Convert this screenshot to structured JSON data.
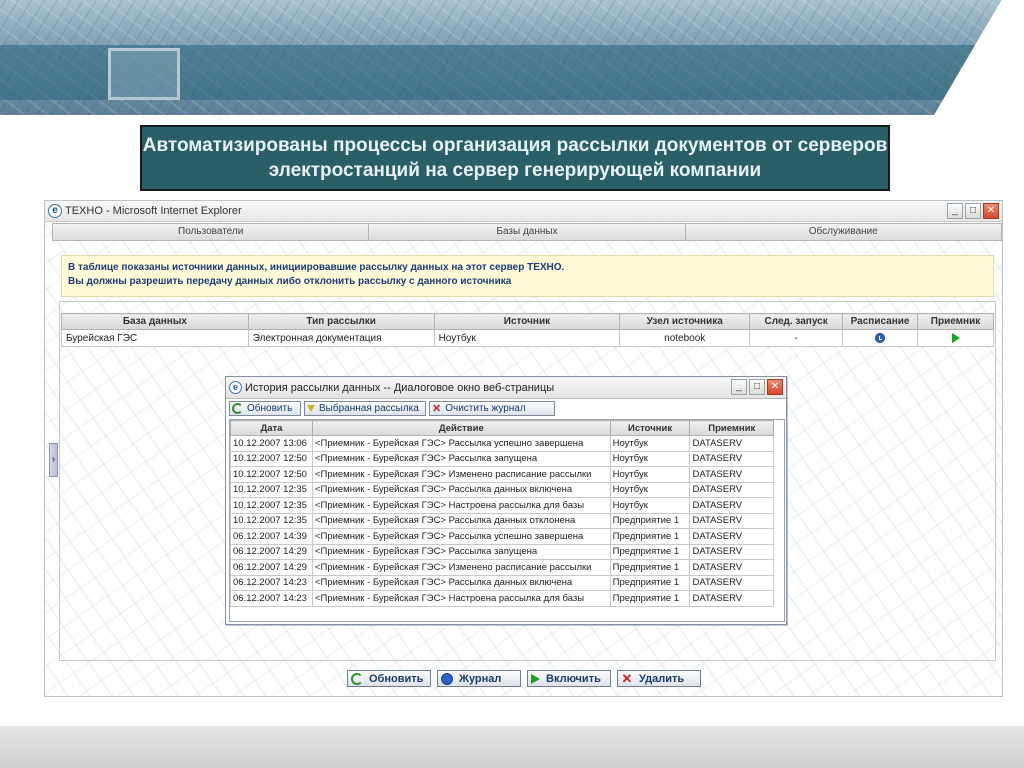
{
  "slide": {
    "title": "Автоматизированы процессы организация рассылки документов от серверов электростанций на сервер генерирующей компании"
  },
  "browser": {
    "window_title": "ТЕХНО - Microsoft Internet Explorer",
    "buttons": {
      "minimize": "_",
      "maximize": "□",
      "close": "✕"
    }
  },
  "nav": {
    "tabs": [
      "Пользователи",
      "Базы данных",
      "Обслуживание"
    ]
  },
  "info": {
    "line1": "В таблице показаны источники данных, инициировавшие рассылку данных на этот сервер ТЕХНО.",
    "line2": "Вы должны разрешить передачу данных либо отклонить рассылку с данного источника"
  },
  "sources_table": {
    "headers": [
      "База данных",
      "Тип рассылки",
      "Источник",
      "Узел источника",
      "След. запуск",
      "Расписание",
      "Приемник"
    ],
    "rows": [
      {
        "database": "Бурейская ГЭС",
        "type": "Электронная документация",
        "source": "Ноутбук",
        "node": "notebook",
        "next_run": "-",
        "schedule_icon": "clock-icon",
        "receiver_icon": "play-icon"
      }
    ]
  },
  "bottom_buttons": {
    "refresh": "Обновить",
    "journal": "Журнал",
    "enable": "Включить",
    "delete": "Удалить"
  },
  "dialog": {
    "title": "История рассылки данных -- Диалоговое окно веб-страницы",
    "toolbar": {
      "refresh": "Обновить",
      "filter": "Выбранная рассылка",
      "clear": "Очистить журнал"
    },
    "headers": [
      "Дата",
      "Действие",
      "Источник",
      "Приемник"
    ],
    "rows": [
      {
        "date": "10.12.2007 13:06",
        "action": "<Приемник - Бурейская ГЭС> Рассылка успешно завершена",
        "source": "Ноутбук",
        "receiver": "DATASERV"
      },
      {
        "date": "10.12.2007 12:50",
        "action": "<Приемник - Бурейская ГЭС> Рассылка запущена",
        "source": "Ноутбук",
        "receiver": "DATASERV"
      },
      {
        "date": "10.12.2007 12:50",
        "action": "<Приемник - Бурейская ГЭС> Изменено расписание рассылки",
        "source": "Ноутбук",
        "receiver": "DATASERV"
      },
      {
        "date": "10.12.2007 12:35",
        "action": "<Приемник - Бурейская ГЭС> Рассылка данных включена",
        "source": "Ноутбук",
        "receiver": "DATASERV"
      },
      {
        "date": "10.12.2007 12:35",
        "action": "<Приемник - Бурейская ГЭС> Настроена рассылка для базы",
        "source": "Ноутбук",
        "receiver": "DATASERV"
      },
      {
        "date": "10.12.2007 12:35",
        "action": "<Приемник - Бурейская ГЭС> Рассылка данных отклонена",
        "source": "Предприятие 1",
        "receiver": "DATASERV"
      },
      {
        "date": "06.12.2007 14:39",
        "action": "<Приемник - Бурейская ГЭС> Рассылка успешно завершена",
        "source": "Предприятие 1",
        "receiver": "DATASERV"
      },
      {
        "date": "06.12.2007 14:29",
        "action": "<Приемник - Бурейская ГЭС> Рассылка запущена",
        "source": "Предприятие 1",
        "receiver": "DATASERV"
      },
      {
        "date": "06.12.2007 14:29",
        "action": "<Приемник - Бурейская ГЭС> Изменено расписание рассылки",
        "source": "Предприятие 1",
        "receiver": "DATASERV"
      },
      {
        "date": "06.12.2007 14:23",
        "action": "<Приемник - Бурейская ГЭС> Рассылка данных включена",
        "source": "Предприятие 1",
        "receiver": "DATASERV"
      },
      {
        "date": "06.12.2007 14:23",
        "action": "<Приемник - Бурейская ГЭС> Настроена рассылка для базы",
        "source": "Предприятие 1",
        "receiver": "DATASERV"
      }
    ]
  }
}
